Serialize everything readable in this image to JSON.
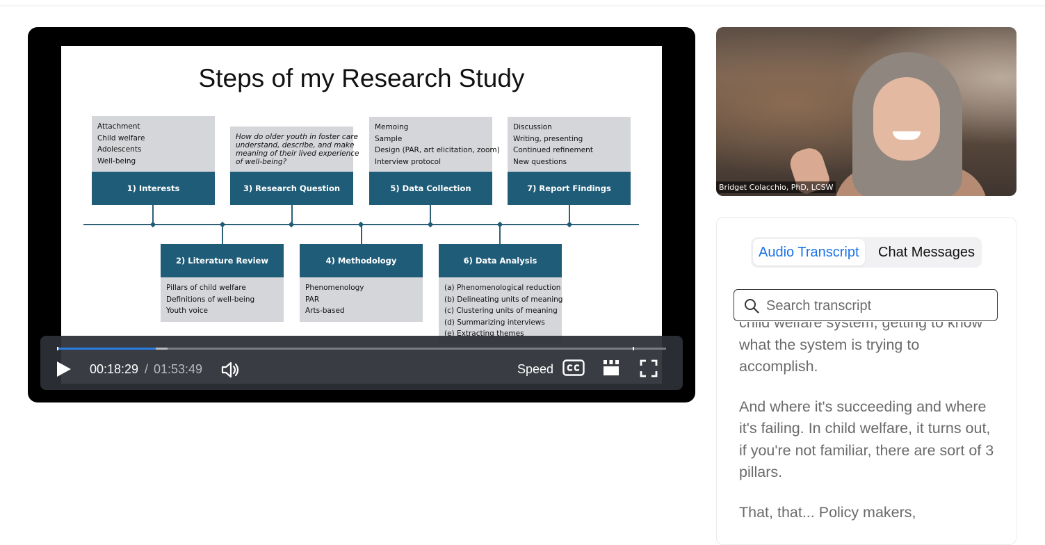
{
  "slide": {
    "title": "Steps of my Research Study",
    "steps_top": [
      {
        "label": "1) Interests",
        "items": [
          "Attachment",
          "Child welfare",
          "Adolescents",
          "Well-being"
        ]
      },
      {
        "label": "3) Research Question",
        "items": [
          "How do older youth in foster care",
          "understand, describe, and make",
          "meaning of their lived experience",
          "of well-being?"
        ]
      },
      {
        "label": "5) Data Collection",
        "items": [
          "Memoing",
          "Sample",
          "Design (PAR, art elicitation, zoom)",
          "Interview protocol"
        ]
      },
      {
        "label": "7) Report Findings",
        "items": [
          "Discussion",
          "Writing, presenting",
          "Continued refinement",
          "New questions"
        ]
      }
    ],
    "steps_bottom": [
      {
        "label": "2) Literature Review",
        "items": [
          "Pillars of child welfare",
          "Definitions of well-being",
          "Youth voice"
        ]
      },
      {
        "label": "4) Methodology",
        "items": [
          "Phenomenology",
          "PAR",
          "Arts-based"
        ]
      },
      {
        "label": "6) Data Analysis",
        "items": [
          "(a) Phenomenological reduction",
          "(b) Delineating units of meaning",
          "(c) Clustering units of meaning",
          "(d) Summarizing interviews",
          "(e) Extracting themes"
        ]
      }
    ]
  },
  "player": {
    "current_time": "00:18:29",
    "separator": "/",
    "total_time": "01:53:49",
    "speed_label": "Speed",
    "progress_fraction": 0.162,
    "buffered_fraction": 0.182,
    "accent_color": "#2a7de1"
  },
  "speaker": {
    "name": "Bridget Colacchio, PhD, LCSW"
  },
  "panel": {
    "tabs": [
      {
        "label": "Audio Transcript",
        "active": true
      },
      {
        "label": "Chat Messages",
        "active": false
      }
    ],
    "search_placeholder": "Search transcript",
    "paragraphs": [
      "child welfare system, getting to know what the system is trying to accomplish.",
      "And where it's succeeding and where it's failing. In child welfare, it turns out, if you're not familiar, there are sort of 3 pillars.",
      "That, that... Policy makers,"
    ]
  }
}
